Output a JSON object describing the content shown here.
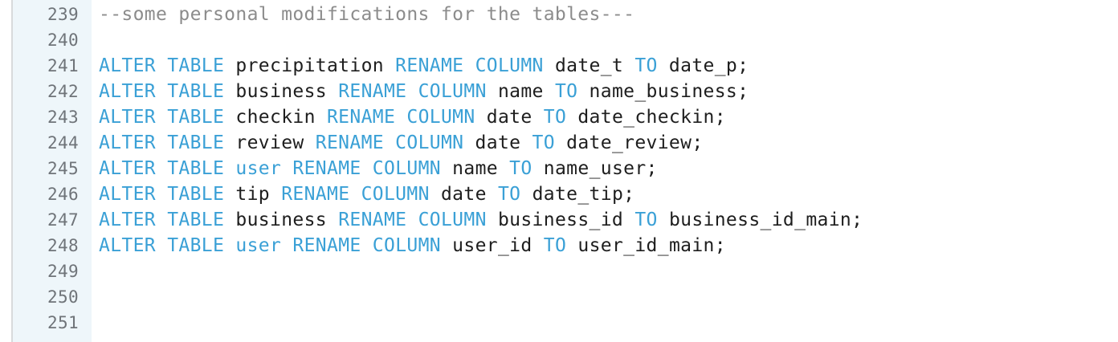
{
  "editor": {
    "colors": {
      "keyword": "#3aa0d6",
      "comment": "#8c8c8c",
      "text": "#1e1e1e",
      "line_number": "#6f7479",
      "gutter_bg": "#eef6fa"
    },
    "lines": [
      {
        "number": "239",
        "tokens": [
          {
            "type": "comment",
            "text": "--some personal modifications for the tables---"
          }
        ]
      },
      {
        "number": "240",
        "tokens": []
      },
      {
        "number": "241",
        "tokens": [
          {
            "type": "kw",
            "text": "ALTER"
          },
          {
            "type": "plain",
            "text": " "
          },
          {
            "type": "kw",
            "text": "TABLE"
          },
          {
            "type": "plain",
            "text": " precipitation "
          },
          {
            "type": "kw",
            "text": "RENAME"
          },
          {
            "type": "plain",
            "text": " "
          },
          {
            "type": "kw",
            "text": "COLUMN"
          },
          {
            "type": "plain",
            "text": " date_t "
          },
          {
            "type": "kw",
            "text": "TO"
          },
          {
            "type": "plain",
            "text": " date_p;"
          }
        ]
      },
      {
        "number": "242",
        "tokens": [
          {
            "type": "kw",
            "text": "ALTER"
          },
          {
            "type": "plain",
            "text": " "
          },
          {
            "type": "kw",
            "text": "TABLE"
          },
          {
            "type": "plain",
            "text": " business "
          },
          {
            "type": "kw",
            "text": "RENAME"
          },
          {
            "type": "plain",
            "text": " "
          },
          {
            "type": "kw",
            "text": "COLUMN"
          },
          {
            "type": "plain",
            "text": " name "
          },
          {
            "type": "kw",
            "text": "TO"
          },
          {
            "type": "plain",
            "text": " name_business;"
          }
        ]
      },
      {
        "number": "243",
        "tokens": [
          {
            "type": "kw",
            "text": "ALTER"
          },
          {
            "type": "plain",
            "text": " "
          },
          {
            "type": "kw",
            "text": "TABLE"
          },
          {
            "type": "plain",
            "text": " checkin "
          },
          {
            "type": "kw",
            "text": "RENAME"
          },
          {
            "type": "plain",
            "text": " "
          },
          {
            "type": "kw",
            "text": "COLUMN"
          },
          {
            "type": "plain",
            "text": " date "
          },
          {
            "type": "kw",
            "text": "TO"
          },
          {
            "type": "plain",
            "text": " date_checkin;"
          }
        ]
      },
      {
        "number": "244",
        "tokens": [
          {
            "type": "kw",
            "text": "ALTER"
          },
          {
            "type": "plain",
            "text": " "
          },
          {
            "type": "kw",
            "text": "TABLE"
          },
          {
            "type": "plain",
            "text": " review "
          },
          {
            "type": "kw",
            "text": "RENAME"
          },
          {
            "type": "plain",
            "text": " "
          },
          {
            "type": "kw",
            "text": "COLUMN"
          },
          {
            "type": "plain",
            "text": " date "
          },
          {
            "type": "kw",
            "text": "TO"
          },
          {
            "type": "plain",
            "text": " date_review;"
          }
        ]
      },
      {
        "number": "245",
        "tokens": [
          {
            "type": "kw",
            "text": "ALTER"
          },
          {
            "type": "plain",
            "text": " "
          },
          {
            "type": "kw",
            "text": "TABLE"
          },
          {
            "type": "plain",
            "text": " "
          },
          {
            "type": "kw",
            "text": "user"
          },
          {
            "type": "plain",
            "text": " "
          },
          {
            "type": "kw",
            "text": "RENAME"
          },
          {
            "type": "plain",
            "text": " "
          },
          {
            "type": "kw",
            "text": "COLUMN"
          },
          {
            "type": "plain",
            "text": " name "
          },
          {
            "type": "kw",
            "text": "TO"
          },
          {
            "type": "plain",
            "text": " name_user;"
          }
        ]
      },
      {
        "number": "246",
        "tokens": [
          {
            "type": "kw",
            "text": "ALTER"
          },
          {
            "type": "plain",
            "text": " "
          },
          {
            "type": "kw",
            "text": "TABLE"
          },
          {
            "type": "plain",
            "text": " tip "
          },
          {
            "type": "kw",
            "text": "RENAME"
          },
          {
            "type": "plain",
            "text": " "
          },
          {
            "type": "kw",
            "text": "COLUMN"
          },
          {
            "type": "plain",
            "text": " date "
          },
          {
            "type": "kw",
            "text": "TO"
          },
          {
            "type": "plain",
            "text": " date_tip;"
          }
        ]
      },
      {
        "number": "247",
        "tokens": [
          {
            "type": "kw",
            "text": "ALTER"
          },
          {
            "type": "plain",
            "text": " "
          },
          {
            "type": "kw",
            "text": "TABLE"
          },
          {
            "type": "plain",
            "text": " business "
          },
          {
            "type": "kw",
            "text": "RENAME"
          },
          {
            "type": "plain",
            "text": " "
          },
          {
            "type": "kw",
            "text": "COLUMN"
          },
          {
            "type": "plain",
            "text": " business_id "
          },
          {
            "type": "kw",
            "text": "TO"
          },
          {
            "type": "plain",
            "text": " business_id_main;"
          }
        ]
      },
      {
        "number": "248",
        "tokens": [
          {
            "type": "kw",
            "text": "ALTER"
          },
          {
            "type": "plain",
            "text": " "
          },
          {
            "type": "kw",
            "text": "TABLE"
          },
          {
            "type": "plain",
            "text": " "
          },
          {
            "type": "kw",
            "text": "user"
          },
          {
            "type": "plain",
            "text": " "
          },
          {
            "type": "kw",
            "text": "RENAME"
          },
          {
            "type": "plain",
            "text": " "
          },
          {
            "type": "kw",
            "text": "COLUMN"
          },
          {
            "type": "plain",
            "text": " user_id "
          },
          {
            "type": "kw",
            "text": "TO"
          },
          {
            "type": "plain",
            "text": " user_id_main;"
          }
        ]
      },
      {
        "number": "249",
        "tokens": []
      },
      {
        "number": "250",
        "tokens": []
      },
      {
        "number": "251",
        "tokens": []
      }
    ]
  }
}
